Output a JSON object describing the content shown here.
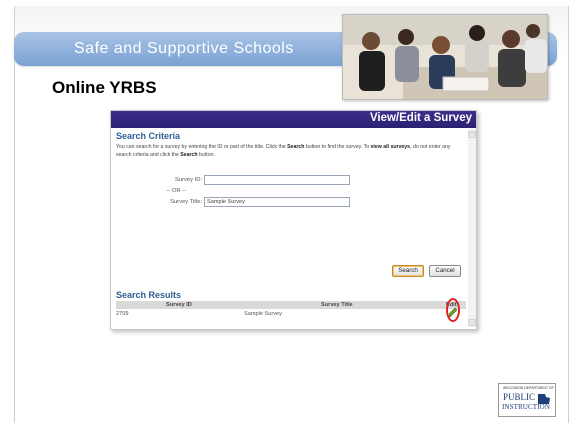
{
  "banner": {
    "title": "Safe and Supportive Schools"
  },
  "subtitle": "Online YRBS",
  "window": {
    "header_title": "View/Edit a Survey",
    "search_criteria": {
      "title": "Search Criteria",
      "desc_part1": "You can search for a survey by entering the ID or part of the title. Click the ",
      "desc_bold1": "Search",
      "desc_part2": " button to find the survey. To ",
      "desc_bold2": "view all surveys",
      "desc_part3": ", do not enter any search criteria and click the ",
      "desc_bold3": "Search",
      "desc_part4": " button.",
      "survey_id_label": "Survey ID:",
      "survey_id_value": "",
      "or_label": "-- OR --",
      "survey_title_label": "Survey Title:",
      "survey_title_value": "Sample Survey",
      "search_button": "Search",
      "cancel_button": "Cancel"
    },
    "search_results": {
      "title": "Search Results",
      "columns": [
        "Survey ID",
        "Survey Title",
        "Edit"
      ],
      "rows": [
        {
          "id": "2709",
          "title": "Sample Survey"
        }
      ]
    }
  },
  "logo": {
    "top": "WISCONSIN DEPARTMENT OF",
    "public": "PUBLIC",
    "instruction": "INSTRUCTION"
  },
  "colors": {
    "banner": "#8fb1dc",
    "header": "#2b2170",
    "section_title": "#2e5f93",
    "highlight": "#d22222"
  }
}
